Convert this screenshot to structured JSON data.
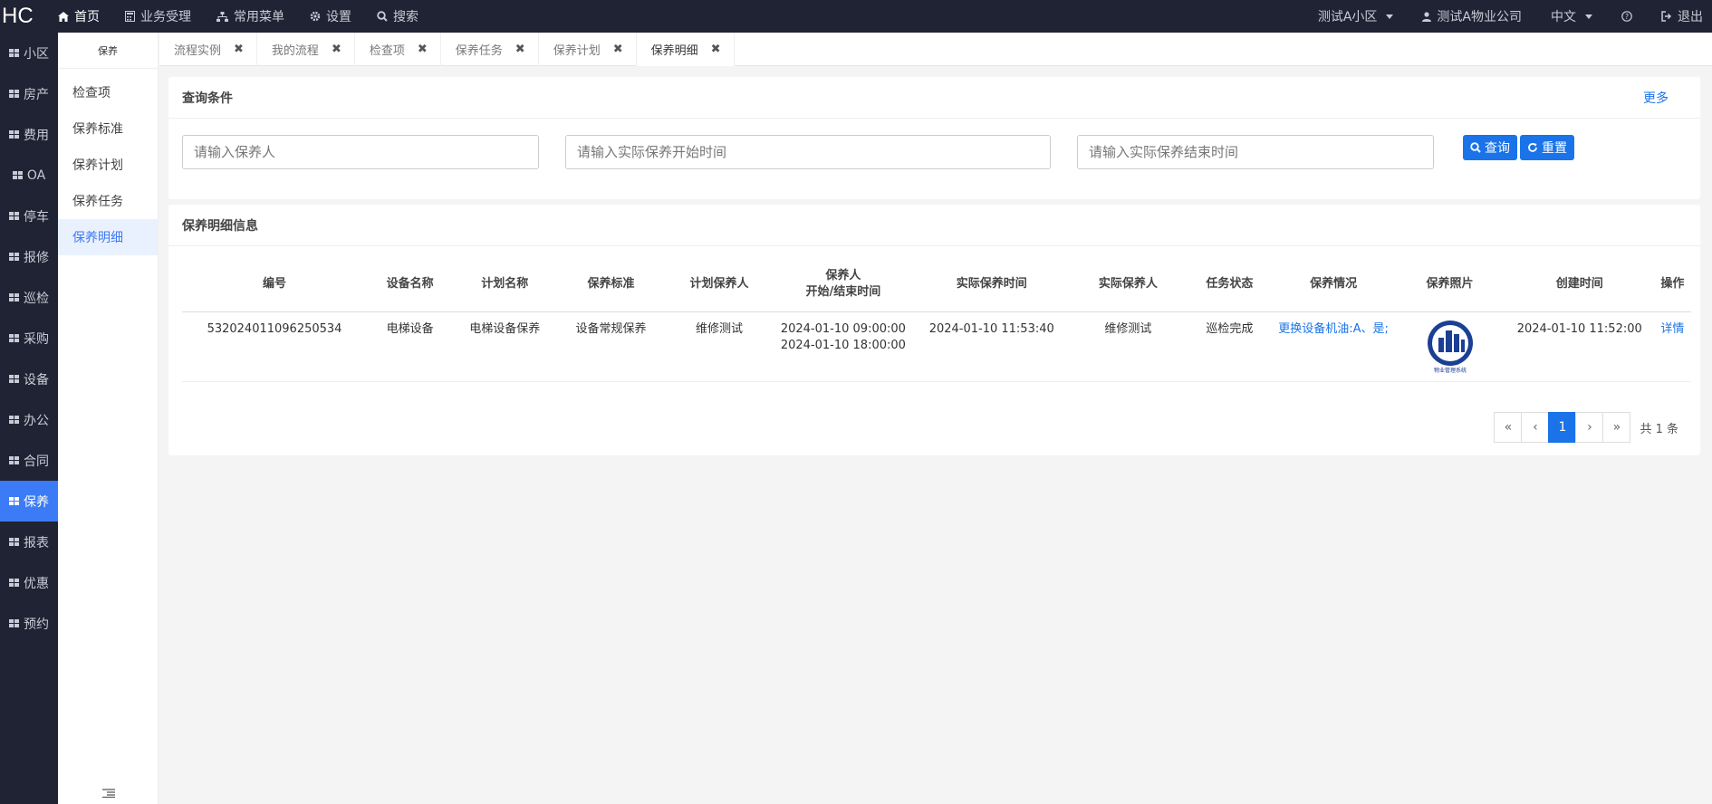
{
  "topbar": {
    "logo": "HC",
    "nav": [
      {
        "label": "首页",
        "icon": "home-icon"
      },
      {
        "label": "业务受理",
        "icon": "calculator-icon"
      },
      {
        "label": "常用菜单",
        "icon": "sitemap-icon"
      },
      {
        "label": "设置",
        "icon": "gear-icon"
      },
      {
        "label": "搜索",
        "icon": "search-icon"
      }
    ],
    "community": "测试A小区",
    "company": "测试A物业公司",
    "language": "中文",
    "help": "?",
    "logout": "退出"
  },
  "sidebar": {
    "items": [
      "小区",
      "房产",
      "费用",
      "OA",
      "停车",
      "报修",
      "巡检",
      "采购",
      "设备",
      "办公",
      "合同",
      "保养",
      "报表",
      "优惠",
      "预约"
    ],
    "active": "保养"
  },
  "subbar": {
    "title": "保养",
    "items": [
      "检查项",
      "保养标准",
      "保养计划",
      "保养任务",
      "保养明细"
    ],
    "active": "保养明细"
  },
  "tabs": [
    "流程实例",
    "我的流程",
    "检查项",
    "保养任务",
    "保养计划",
    "保养明细"
  ],
  "query": {
    "title": "查询条件",
    "more": "更多",
    "maintainer_placeholder": "请输入保养人",
    "start_placeholder": "请输入实际保养开始时间",
    "end_placeholder": "请输入实际保养结束时间",
    "search_label": "查询",
    "reset_label": "重置"
  },
  "list": {
    "title": "保养明细信息",
    "headers": [
      "编号",
      "设备名称",
      "计划名称",
      "保养标准",
      "计划保养人",
      "保养人",
      "开始/结束时间",
      "实际保养时间",
      "实际保养人",
      "任务状态",
      "保养情况",
      "保养照片",
      "创建时间",
      "操作"
    ],
    "rows": [
      {
        "id": "532024011096250534",
        "device": "电梯设备",
        "plan": "电梯设备保养",
        "standard": "设备常规保养",
        "planned_person": "维修测试",
        "start": "2024-01-10 09:00:00",
        "end": "2024-01-10 18:00:00",
        "actual_time": "2024-01-10 11:53:40",
        "actual_person": "维修测试",
        "status": "巡检完成",
        "situation": "更换设备机油:A、是;",
        "photo_caption": "物业管理系统",
        "created": "2024-01-10 11:52:00",
        "action": "详情"
      }
    ]
  },
  "pager": {
    "first": "«",
    "prev": "‹",
    "current": "1",
    "next": "›",
    "last": "»",
    "total": "共 1 条"
  }
}
